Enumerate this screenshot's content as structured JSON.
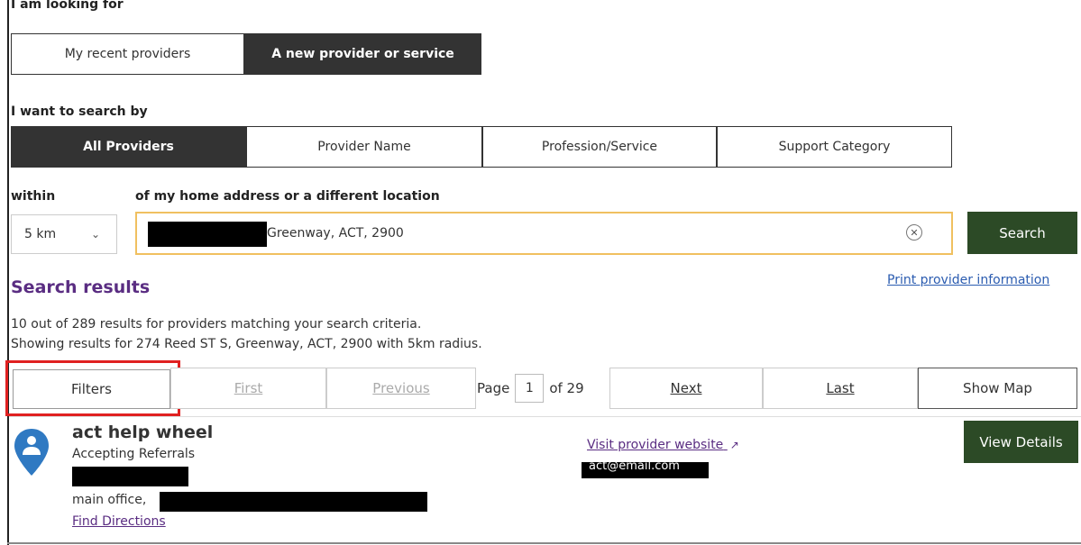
{
  "looking_for": {
    "label": "I am looking for",
    "options": [
      "My recent providers",
      "A new provider or service"
    ],
    "active_index": 1
  },
  "search_by": {
    "label": "I want to search by",
    "options": [
      "All Providers",
      "Provider Name",
      "Profession/Service",
      "Support Category"
    ],
    "active_index": 0
  },
  "location": {
    "within_label": "within",
    "address_label": "of my home address or a different location",
    "radius_value": "5 km",
    "address_value": "Greenway, ACT, 2900",
    "search_button": "Search"
  },
  "results": {
    "title": "Search results",
    "print_link": "Print provider information",
    "summary_line1": "10 out of 289 results for providers matching your search criteria.",
    "summary_line2": "Showing results for 274 Reed ST S, Greenway, ACT, 2900 with 5km radius."
  },
  "pagination": {
    "filters": "Filters",
    "first": "First",
    "previous": "Previous",
    "page_label": "Page",
    "page_value": "1",
    "of_label": "of 29",
    "next": "Next",
    "last": "Last",
    "show_map": "Show Map"
  },
  "provider": {
    "name": "act help wheel",
    "status": "Accepting Referrals",
    "office": "main office,",
    "directions": "Find Directions",
    "website_link": "Visit provider website",
    "email": "act@email.com",
    "view_details": "View Details"
  },
  "colors": {
    "accent_dark": "#333333",
    "brand_green": "#2c4a26",
    "heading_purple": "#5a2d82",
    "focus_outline": "#f0c060",
    "highlight_red": "#e02020",
    "pin_blue": "#2f79c2"
  }
}
